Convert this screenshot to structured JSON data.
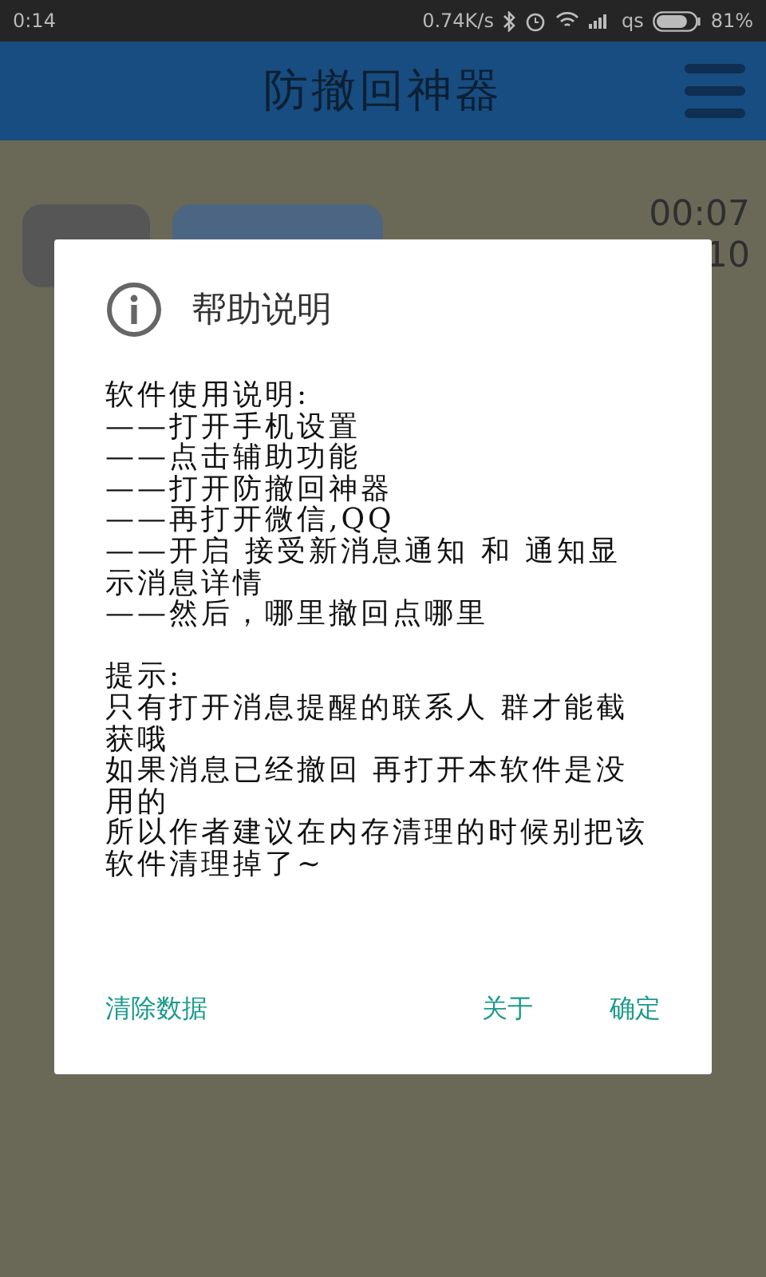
{
  "status_bar": {
    "time": "0:14",
    "speed": "0.74K/s",
    "carrier": "qs",
    "battery": "81%"
  },
  "app_bar": {
    "title": "防撤回神器"
  },
  "messages": [
    {
      "time": "00:07"
    },
    {
      "time": "10"
    }
  ],
  "dialog": {
    "title": "帮助说明",
    "sections": [
      [
        "软件使用说明:",
        "——打开手机设置",
        "——点击辅助功能",
        "——打开防撤回神器",
        "——再打开微信,QQ",
        "——开启 接受新消息通知 和 通知显示消息详情",
        "——然后，哪里撤回点哪里"
      ],
      [
        "提示:",
        "只有打开消息提醒的联系人 群才能截获哦",
        "如果消息已经撤回 再打开本软件是没用的",
        "所以作者建议在内存清理的时候别把该软件清理掉了~"
      ]
    ],
    "buttons": [
      {
        "label": "清除数据",
        "kind": "left"
      },
      {
        "label": "关于",
        "kind": "right"
      },
      {
        "label": "确定",
        "kind": "right"
      }
    ]
  }
}
